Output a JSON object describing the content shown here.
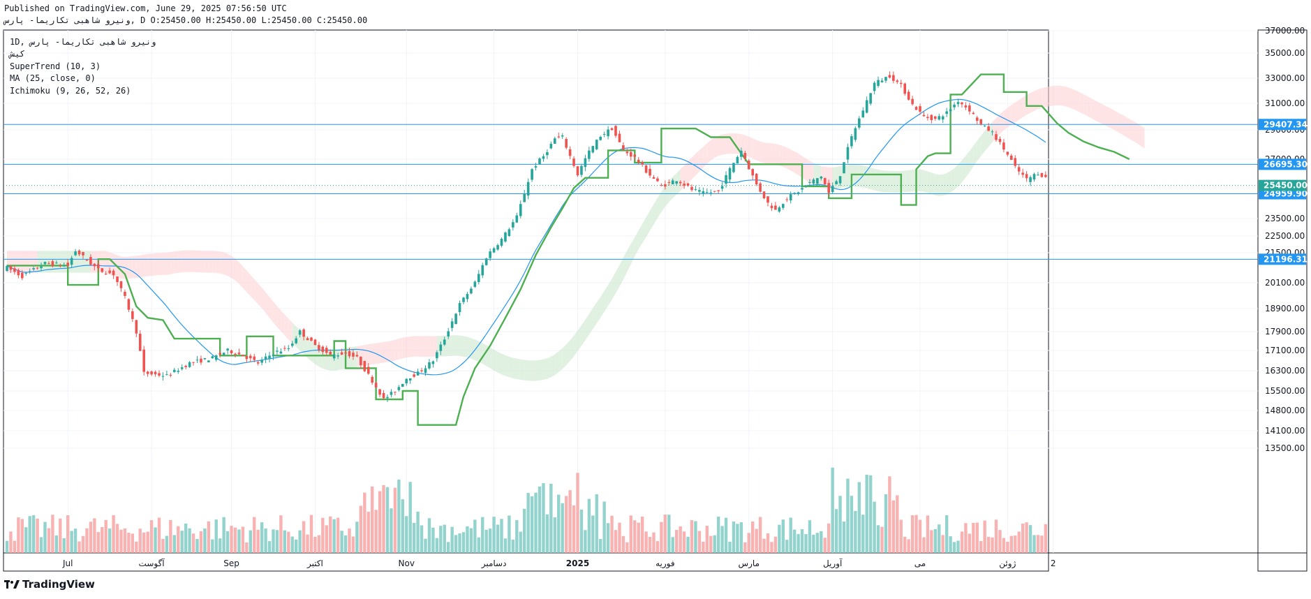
{
  "header": {
    "published": "Published on TradingView.com, June 29, 2025 07:56:50 UTC",
    "symbol_line": "ونیرو شاهبی تکاریما- پارس, D O:25450.00 H:25450.00 L:25450.00 C:25450.00"
  },
  "legend": {
    "line1": "1D, ونیرو شاهبی تکاریما- پارس",
    "line2": "کیش",
    "supertrend": "SuperTrend (10, 3)",
    "ma": "MA (25, close, 0)",
    "ichimoku": "Ichimoku (9, 26, 52, 26)"
  },
  "footer": {
    "brand": "TradingView"
  },
  "colors": {
    "up": "#26a69a",
    "down": "#ef5350",
    "supertrend": "#4caf50",
    "ma": "#2196f3",
    "tenkan": "#a04747",
    "hline": "#2196f3",
    "cloud_bull": "#c8e6c9",
    "cloud_bear": "#ffcdd2",
    "tag_green": "#26a69a"
  },
  "chart_data": {
    "type": "candlestick",
    "x_labels": [
      {
        "label": "Jul",
        "i": 16
      },
      {
        "label": "آگوست",
        "i": 38
      },
      {
        "label": "Sep",
        "i": 59
      },
      {
        "label": "اکتبر",
        "i": 81
      },
      {
        "label": "Nov",
        "i": 105
      },
      {
        "label": "دسامبر",
        "i": 128
      },
      {
        "label": "2025",
        "i": 150
      },
      {
        "label": "فوریه",
        "i": 173
      },
      {
        "label": "مارس",
        "i": 195
      },
      {
        "label": "آوریل",
        "i": 217
      },
      {
        "label": "می",
        "i": 240
      },
      {
        "label": "ژوئن",
        "i": 263
      },
      {
        "label": "2",
        "i": 275
      }
    ],
    "y_ticks": [
      "37000.00",
      "35000.00",
      "33000.00",
      "31000.00",
      "29000.00",
      "27000.00",
      "23500.00",
      "22500.00",
      "21500.00",
      "20100.00",
      "18900.00",
      "17900.00",
      "17100.00",
      "16300.00",
      "15500.00",
      "14800.00",
      "14100.00",
      "13500.00"
    ],
    "y_tick_values": [
      37000,
      35000,
      33000,
      31000,
      29000,
      27000,
      23500,
      22500,
      21500,
      20100,
      18900,
      17900,
      17100,
      16300,
      15500,
      14800,
      14100,
      13500
    ],
    "price_lines": [
      {
        "value": 29407.34,
        "label": "29407.34"
      },
      {
        "value": 26695.3,
        "label": "26695.30"
      },
      {
        "value": 24959.9,
        "label": "24959.90"
      },
      {
        "value": 21196.31,
        "label": "21196.31"
      }
    ],
    "last_price": {
      "value": 25450.0,
      "label": "25450.00"
    },
    "anchors": [
      [
        0,
        20800
      ],
      [
        4,
        20400
      ],
      [
        10,
        21000
      ],
      [
        16,
        20900
      ],
      [
        18,
        21600
      ],
      [
        24,
        20700
      ],
      [
        28,
        20500
      ],
      [
        31,
        19400
      ],
      [
        34,
        17900
      ],
      [
        36,
        16200
      ],
      [
        42,
        16100
      ],
      [
        48,
        16600
      ],
      [
        54,
        16800
      ],
      [
        58,
        17100
      ],
      [
        62,
        16900
      ],
      [
        66,
        16600
      ],
      [
        70,
        17000
      ],
      [
        74,
        17200
      ],
      [
        77,
        17900
      ],
      [
        81,
        17300
      ],
      [
        85,
        16900
      ],
      [
        89,
        17000
      ],
      [
        92,
        16800
      ],
      [
        96,
        15900
      ],
      [
        99,
        15200
      ],
      [
        102,
        15500
      ],
      [
        105,
        16000
      ],
      [
        108,
        16200
      ],
      [
        112,
        16700
      ],
      [
        115,
        17600
      ],
      [
        119,
        19100
      ],
      [
        123,
        20100
      ],
      [
        126,
        21300
      ],
      [
        130,
        22300
      ],
      [
        134,
        23600
      ],
      [
        138,
        26400
      ],
      [
        141,
        27200
      ],
      [
        144,
        28400
      ],
      [
        146,
        28500
      ],
      [
        148,
        27200
      ],
      [
        150,
        26100
      ],
      [
        153,
        27500
      ],
      [
        156,
        28600
      ],
      [
        159,
        29100
      ],
      [
        162,
        27600
      ],
      [
        165,
        27100
      ],
      [
        168,
        26300
      ],
      [
        172,
        25400
      ],
      [
        176,
        25800
      ],
      [
        180,
        25200
      ],
      [
        183,
        25000
      ],
      [
        187,
        25100
      ],
      [
        190,
        26400
      ],
      [
        193,
        27600
      ],
      [
        195,
        26500
      ],
      [
        197,
        25500
      ],
      [
        200,
        24400
      ],
      [
        202,
        24000
      ],
      [
        205,
        24700
      ],
      [
        208,
        25100
      ],
      [
        211,
        25600
      ],
      [
        214,
        26000
      ],
      [
        216,
        25000
      ],
      [
        219,
        26100
      ],
      [
        222,
        28500
      ],
      [
        225,
        30500
      ],
      [
        228,
        32600
      ],
      [
        232,
        33200
      ],
      [
        235,
        32400
      ],
      [
        238,
        30900
      ],
      [
        241,
        30000
      ],
      [
        244,
        29800
      ],
      [
        247,
        30300
      ],
      [
        250,
        31200
      ],
      [
        253,
        30500
      ],
      [
        256,
        29400
      ],
      [
        259,
        28800
      ],
      [
        262,
        27700
      ],
      [
        265,
        26500
      ],
      [
        268,
        25800
      ],
      [
        271,
        26200
      ],
      [
        273,
        25900
      ]
    ],
    "supertrend_anchors": [
      [
        0,
        20900
      ],
      [
        16,
        20900
      ],
      [
        16,
        20000
      ],
      [
        24,
        20000
      ],
      [
        24,
        21200
      ],
      [
        27,
        21200
      ],
      [
        27,
        21200
      ],
      [
        31,
        20500
      ],
      [
        34,
        19000
      ],
      [
        37,
        18500
      ],
      [
        41,
        18400
      ],
      [
        44,
        17600
      ],
      [
        50,
        17600
      ],
      [
        56,
        17600
      ],
      [
        56,
        16900
      ],
      [
        63,
        16900
      ],
      [
        63,
        17700
      ],
      [
        70,
        17700
      ],
      [
        70,
        16900
      ],
      [
        86,
        16900
      ],
      [
        86,
        17500
      ],
      [
        89,
        17500
      ],
      [
        89,
        16400
      ],
      [
        97,
        16400
      ],
      [
        97,
        15200
      ],
      [
        104,
        15200
      ],
      [
        104,
        15500
      ],
      [
        108,
        15500
      ],
      [
        108,
        14300
      ],
      [
        118,
        14300
      ],
      [
        120,
        15300
      ],
      [
        123,
        16400
      ],
      [
        127,
        17300
      ],
      [
        131,
        18500
      ],
      [
        135,
        19800
      ],
      [
        139,
        21400
      ],
      [
        143,
        23000
      ],
      [
        146,
        24100
      ],
      [
        149,
        25300
      ],
      [
        152,
        25900
      ],
      [
        158,
        25900
      ],
      [
        158,
        27600
      ],
      [
        165,
        27600
      ],
      [
        165,
        26800
      ],
      [
        172,
        26800
      ],
      [
        172,
        29100
      ],
      [
        181,
        29100
      ],
      [
        185,
        28500
      ],
      [
        190,
        28500
      ],
      [
        195,
        26700
      ],
      [
        209,
        26700
      ],
      [
        209,
        25400
      ],
      [
        216,
        25400
      ],
      [
        216,
        24700
      ],
      [
        222,
        24700
      ],
      [
        222,
        26100
      ],
      [
        235,
        26100
      ],
      [
        235,
        24300
      ],
      [
        239,
        24300
      ],
      [
        239,
        26400
      ],
      [
        242,
        27200
      ],
      [
        244,
        27400
      ],
      [
        248,
        27400
      ],
      [
        248,
        31700
      ],
      [
        251,
        31700
      ],
      [
        256,
        33300
      ],
      [
        262,
        33300
      ],
      [
        262,
        31900
      ],
      [
        268,
        31900
      ],
      [
        268,
        30800
      ],
      [
        272,
        30800
      ],
      [
        276,
        29500
      ],
      [
        279,
        28800
      ],
      [
        283,
        28200
      ],
      [
        287,
        27800
      ],
      [
        291,
        27500
      ],
      [
        295,
        27000
      ]
    ]
  }
}
